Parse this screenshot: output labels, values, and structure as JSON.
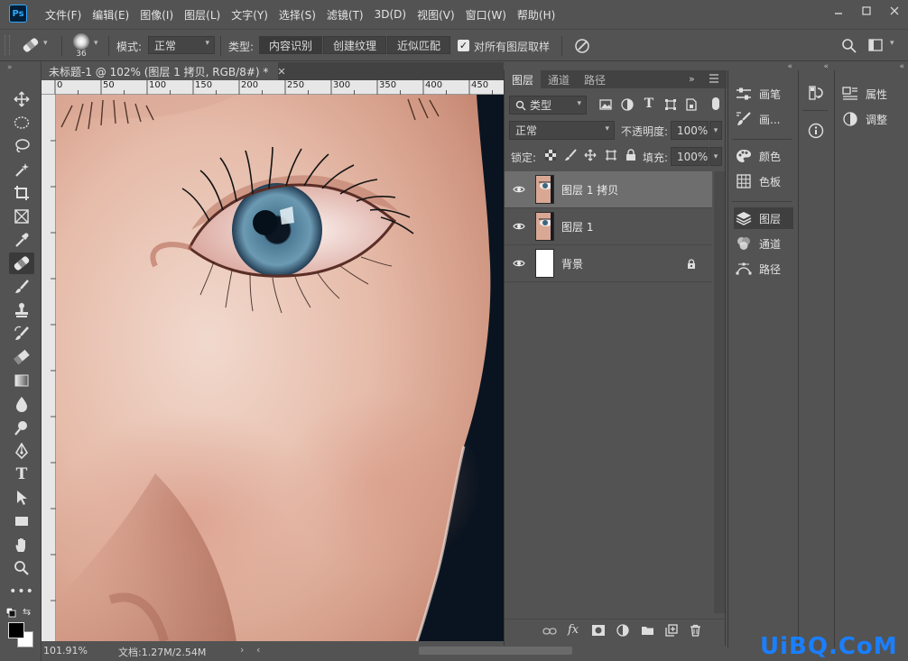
{
  "app": {
    "logo_text": "Ps",
    "menus": [
      "文件(F)",
      "编辑(E)",
      "图像(I)",
      "图层(L)",
      "文字(Y)",
      "选择(S)",
      "滤镜(T)",
      "3D(D)",
      "视图(V)",
      "窗口(W)",
      "帮助(H)"
    ],
    "window_controls": [
      "minimize-icon",
      "maximize-icon",
      "close-icon"
    ]
  },
  "options_bar": {
    "brush_size": "36",
    "mode_label": "模式:",
    "mode_value": "正常",
    "type_label": "类型:",
    "type_options": [
      "内容识别",
      "创建纹理",
      "近似匹配"
    ],
    "type_selected": "内容识别",
    "sample_all_label": "对所有图层取样",
    "sample_all_checked": true
  },
  "document": {
    "tab_title": "未标题-1 @ 102% (图层 1 拷贝, RGB/8#) *",
    "ruler_ticks": [
      "0",
      "50",
      "100",
      "150",
      "200",
      "250",
      "300",
      "350",
      "400",
      "450"
    ],
    "zoom": "101.91%",
    "doc_info": "文档:1.27M/2.54M"
  },
  "tools": [
    "move-tool",
    "marquee-tool",
    "lasso-tool",
    "quick-select-tool",
    "crop-tool",
    "frame-tool",
    "eyedropper-tool",
    "healing-brush-tool",
    "brush-tool",
    "clone-stamp-tool",
    "history-brush-tool",
    "eraser-tool",
    "gradient-tool",
    "blur-tool",
    "dodge-tool",
    "pen-tool",
    "type-tool",
    "path-select-tool",
    "rectangle-tool",
    "hand-tool",
    "zoom-tool",
    "more-tools"
  ],
  "tool_type_glyph": "T",
  "active_tool": "healing-brush-tool",
  "colors": {
    "foreground": "#000000",
    "background": "#ffffff",
    "watermark": "#1a7fff"
  },
  "layers_panel": {
    "tabs": [
      "图层",
      "通道",
      "路径"
    ],
    "active_tab": "图层",
    "filter_label": "类型",
    "blend_mode": "正常",
    "opacity_label": "不透明度:",
    "opacity": "100%",
    "lock_label": "锁定:",
    "fill_label": "填充:",
    "fill": "100%",
    "filter_type_glyph": "T",
    "fx_label": "fx",
    "layers": [
      {
        "name": "图层 1 拷贝",
        "visible": true,
        "selected": true,
        "locked": false,
        "thumb": "face"
      },
      {
        "name": "图层 1",
        "visible": true,
        "selected": false,
        "locked": false,
        "thumb": "face"
      },
      {
        "name": "背景",
        "visible": true,
        "selected": false,
        "locked": true,
        "thumb": "white"
      }
    ]
  },
  "dock1": {
    "items": [
      {
        "label": "画笔",
        "icon": "brush-settings-icon"
      },
      {
        "label": "画...",
        "icon": "brush-presets-icon"
      },
      {
        "label": "颜色",
        "icon": "color-palette-icon"
      },
      {
        "label": "色板",
        "icon": "swatches-icon"
      },
      {
        "label": "图层",
        "icon": "layers-icon",
        "active": true
      },
      {
        "label": "通道",
        "icon": "channels-icon"
      },
      {
        "label": "路径",
        "icon": "paths-icon"
      }
    ]
  },
  "dock2": {
    "items": [
      "history-icon",
      "info-icon"
    ]
  },
  "dock3": {
    "items": [
      {
        "label": "属性",
        "icon": "properties-icon"
      },
      {
        "label": "调整",
        "icon": "adjustments-icon"
      }
    ]
  },
  "watermark": "UiBQ.CoM"
}
